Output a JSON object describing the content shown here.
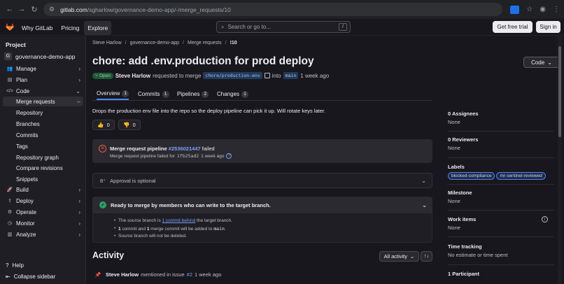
{
  "browser": {
    "url_host": "gitlab.com",
    "url_path": "/sgharlow/governance-demo-app/-/merge_requests/10"
  },
  "topbar": {
    "nav": [
      "Why GitLab",
      "Pricing",
      "Explore"
    ],
    "search_placeholder": "Search or go to...",
    "search_shortcut": "/",
    "free_trial": "Get free trial",
    "sign_in": "Sign in"
  },
  "sidebar": {
    "section_title": "Project",
    "project_initial": "G",
    "project_name": "governance-demo-app",
    "items": [
      {
        "label": "Manage",
        "icon": "people-icon"
      },
      {
        "label": "Plan",
        "icon": "plan-icon"
      },
      {
        "label": "Code",
        "icon": "code-icon"
      },
      {
        "label": "Merge requests",
        "icon": ""
      },
      {
        "label": "Repository",
        "icon": ""
      },
      {
        "label": "Branches",
        "icon": ""
      },
      {
        "label": "Commits",
        "icon": ""
      },
      {
        "label": "Tags",
        "icon": ""
      },
      {
        "label": "Repository graph",
        "icon": ""
      },
      {
        "label": "Compare revisions",
        "icon": ""
      },
      {
        "label": "Snippets",
        "icon": ""
      },
      {
        "label": "Build",
        "icon": "rocket-icon"
      },
      {
        "label": "Deploy",
        "icon": "deploy-icon"
      },
      {
        "label": "Operate",
        "icon": "operate-icon"
      },
      {
        "label": "Monitor",
        "icon": "monitor-icon"
      },
      {
        "label": "Analyze",
        "icon": "chart-icon"
      }
    ],
    "help": "Help",
    "collapse": "Collapse sidebar"
  },
  "breadcrumb": [
    "Steve Harlow",
    "governance-demo-app",
    "Merge requests",
    "!10"
  ],
  "mr": {
    "title": "chore: add .env.production for prod deploy",
    "code_button": "Code",
    "status": "Open",
    "author": "Steve Harlow",
    "requested_text": "requested to merge",
    "source_branch": "chore/production-env",
    "into_text": "into",
    "target_branch": "main",
    "time": "1 week ago"
  },
  "tabs": [
    {
      "label": "Overview",
      "count": "1"
    },
    {
      "label": "Commits",
      "count": "1"
    },
    {
      "label": "Pipelines",
      "count": "2"
    },
    {
      "label": "Changes",
      "count": "1"
    }
  ],
  "description": "Drops the production env file into the repo so the deploy pipeline can pick it up. Will rotate keys later.",
  "reactions": [
    {
      "emoji": "👍",
      "count": "0"
    },
    {
      "emoji": "👎",
      "count": "0"
    }
  ],
  "pipeline": {
    "prefix": "Merge request pipeline",
    "id": "#2536021447",
    "status": "failed",
    "sub_prefix": "Merge request pipeline failed for",
    "sha": "1fb25ad2",
    "sub_time": "1 week ago"
  },
  "approval": {
    "text": "Approval is optional"
  },
  "ready": {
    "title": "Ready to merge by members who can write to the target branch.",
    "line1_prefix": "The source branch is",
    "line1_link": "1 commit behind",
    "line1_suffix": "the target branch.",
    "line2_a": "1",
    "line2_b": "commit and",
    "line2_c": "1",
    "line2_d": "merge commit will be added to",
    "line2_branch": "main",
    "line3": "Source branch will not be deleted."
  },
  "activity": {
    "title": "Activity",
    "filter": "All activity",
    "item_author": "Steve Harlow",
    "item_text": "mentioned in issue",
    "item_link": "#2",
    "item_time": "1 week ago"
  },
  "right_sidebar": {
    "assignees_h": "0 Assignees",
    "assignees_v": "None",
    "reviewers_h": "0 Reviewers",
    "reviewers_v": "None",
    "labels_h": "Labels",
    "labels": [
      "blocked-compliance",
      "mr-sentinel-reviewed"
    ],
    "milestone_h": "Milestone",
    "milestone_v": "None",
    "work_items_h": "Work items",
    "work_items_v": "None",
    "time_h": "Time tracking",
    "time_v": "No estimate or time spent",
    "participants_h": "1 Participant"
  }
}
